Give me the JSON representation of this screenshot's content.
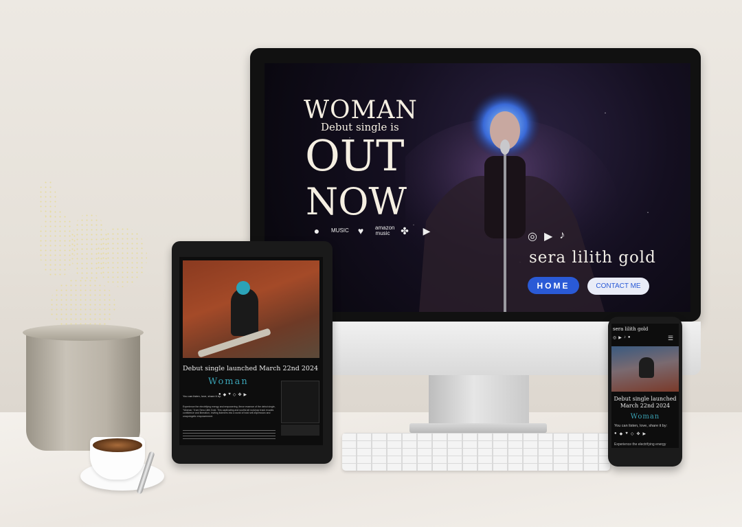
{
  "desktop": {
    "hero": {
      "line1": "WOMAN",
      "line2": "Debut single is",
      "line3": "OUT",
      "line4": "NOW"
    },
    "streaming": [
      {
        "icon": "spotify-icon",
        "glyph": "●",
        "label": ""
      },
      {
        "icon": "apple-music-icon",
        "glyph": "",
        "label": "MUSIC"
      },
      {
        "icon": "deezer-icon",
        "glyph": "♥",
        "label": ""
      },
      {
        "icon": "amazon-music-icon",
        "glyph": "",
        "label": "amazon music"
      },
      {
        "icon": "tidal-icon",
        "glyph": "✤",
        "label": ""
      },
      {
        "icon": "youtube-icon",
        "glyph": "▶",
        "label": ""
      }
    ],
    "socials": [
      {
        "icon": "instagram-icon",
        "glyph": "◎"
      },
      {
        "icon": "youtube-icon",
        "glyph": "▶"
      },
      {
        "icon": "tiktok-icon",
        "glyph": "♪"
      }
    ],
    "artist_name": "sera lilith gold",
    "nav": {
      "home": "HOME",
      "contact": "CONTACT ME"
    }
  },
  "tablet": {
    "title": "Debut single launched March 22nd 2024",
    "single_name": "Woman",
    "share_text": "You can listen, love, share it by:",
    "description": "Experience the electrifying energy and empowering, fierce essence of the debut single, \"Woman,\" from Sera Lilith Gold. This captivating and soulful alt rock/pop track exudes confidence and liberation, inviting listeners into a world of bold self-expression and unapologetic empowerment."
  },
  "phone": {
    "artist_name": "sera lilith gold",
    "title": "Debut single launched March 22nd 2024",
    "single_name": "Woman",
    "share_text": "You can listen, love, share it by:",
    "description_start": "Experience the electrifying energy"
  },
  "colors": {
    "accent_blue": "#2a5ad6",
    "teal": "#3aa3b5"
  }
}
